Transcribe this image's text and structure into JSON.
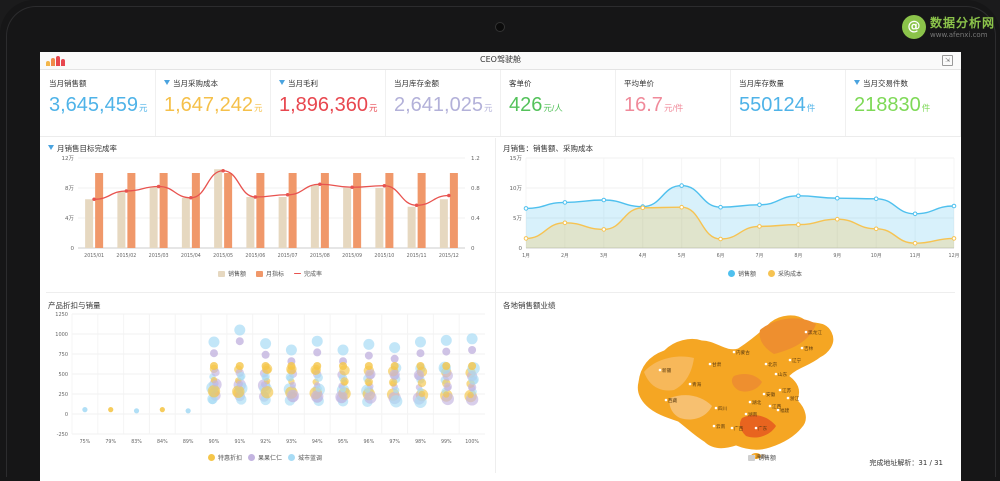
{
  "brand": {
    "name": "数据分析网",
    "url": "www.afenxi.com",
    "logo_glyph": "@"
  },
  "app": {
    "title": "CEO驾驶舱",
    "icon": "bar-logo-icon",
    "exit_icon": "exit-icon",
    "exit_glyph": "⇲"
  },
  "kpis": [
    {
      "label": "当月销售额",
      "value": "3,645,459",
      "unit": "元",
      "color": "#4fb3e8",
      "filter": false
    },
    {
      "label": "当月采购成本",
      "value": "1,647,242",
      "unit": "元",
      "color": "#f5c04a",
      "filter": true
    },
    {
      "label": "当月毛利",
      "value": "1,896,360",
      "unit": "元",
      "color": "#e8474f",
      "filter": true
    },
    {
      "label": "当月库存金额",
      "value": "2,641,025",
      "unit": "元",
      "color": "#b3b1d9",
      "filter": false
    },
    {
      "label": "客单价",
      "value": "426",
      "unit": "元/人",
      "color": "#54c25b",
      "filter": false
    },
    {
      "label": "平均单价",
      "value": "16.7",
      "unit": "元/件",
      "color": "#f08a9a",
      "filter": false
    },
    {
      "label": "当月库存数量",
      "value": "550124",
      "unit": "件",
      "color": "#4fb3e8",
      "filter": false
    },
    {
      "label": "当月交易件数",
      "value": "218830",
      "unit": "件",
      "color": "#7ed957",
      "filter": true
    }
  ],
  "panels": {
    "p1": {
      "title": "月销售目标完成率",
      "filter": true
    },
    "p2": {
      "title": "月销售：销售额、采购成本"
    },
    "p3": {
      "title": "产品折扣与销量"
    },
    "p4": {
      "title": "各地销售额业绩"
    }
  },
  "chart_data": [
    {
      "type": "bar",
      "title": "月销售目标完成率",
      "categories": [
        "2015/01",
        "2015/02",
        "2015/03",
        "2015/04",
        "2015/05",
        "2015/06",
        "2015/07",
        "2015/08",
        "2015/09",
        "2015/10",
        "2015/11",
        "2015/12"
      ],
      "y_ticks": [
        "0",
        "4万",
        "8万",
        "12万"
      ],
      "y2_ticks": [
        "0",
        "0.4",
        "0.8",
        "1.2"
      ],
      "ylim": [
        0,
        120000
      ],
      "y2lim": [
        0,
        1.2
      ],
      "series": [
        {
          "name": "销售额",
          "type": "bar",
          "color": "#e6d8c0",
          "values": [
            65000,
            75000,
            82000,
            67000,
            105000,
            68000,
            68000,
            84000,
            80000,
            80000,
            55000,
            65000
          ]
        },
        {
          "name": "月指标",
          "type": "bar",
          "color": "#f0986a",
          "values": [
            100000,
            100000,
            100000,
            100000,
            100000,
            100000,
            100000,
            100000,
            100000,
            100000,
            100000,
            100000
          ]
        },
        {
          "name": "完成率",
          "type": "line",
          "color": "#e8534f",
          "values": [
            0.65,
            0.76,
            0.82,
            0.67,
            1.03,
            0.68,
            0.71,
            0.85,
            0.81,
            0.83,
            0.57,
            0.7
          ]
        }
      ]
    },
    {
      "type": "area",
      "title": "月销售：销售额、采购成本",
      "categories": [
        "1月",
        "2月",
        "3月",
        "4月",
        "5月",
        "6月",
        "7月",
        "8月",
        "9月",
        "10月",
        "11月",
        "12月"
      ],
      "y_ticks": [
        "0",
        "5万",
        "10万",
        "15万"
      ],
      "ylim": [
        0,
        150000
      ],
      "series": [
        {
          "name": "销售额",
          "color": "#4fc0ee",
          "values": [
            66000,
            76000,
            80000,
            69000,
            104000,
            68000,
            72000,
            87000,
            83000,
            82000,
            57000,
            70000
          ]
        },
        {
          "name": "采购成本",
          "color": "#f6c352",
          "values": [
            16000,
            42000,
            31000,
            67000,
            68000,
            15000,
            36000,
            39000,
            48000,
            32000,
            8000,
            16000
          ]
        }
      ]
    },
    {
      "type": "scatter",
      "title": "产品折扣与销量",
      "categories": [
        "75%",
        "79%",
        "83%",
        "84%",
        "89%",
        "90%",
        "91%",
        "92%",
        "93%",
        "94%",
        "95%",
        "96%",
        "97%",
        "98%",
        "99%",
        "100%"
      ],
      "y_ticks": [
        "-250",
        "0",
        "250",
        "500",
        "750",
        "1000",
        "1250"
      ],
      "ylim": [
        -250,
        1250
      ],
      "series": [
        {
          "name": "特惠折扣",
          "color": "#f5c64a"
        },
        {
          "name": "果果仁仁",
          "color": "#c3b4e0"
        },
        {
          "name": "城市蓝调",
          "color": "#a8dcf5"
        }
      ]
    },
    {
      "type": "map",
      "title": "各地销售额业绩",
      "legend": [
        "销售额"
      ],
      "labels": [
        "新疆",
        "西藏",
        "青海",
        "甘肃",
        "四川",
        "内蒙古",
        "黑龙江",
        "吉林",
        "辽宁",
        "北京",
        "山东",
        "江苏",
        "安徽",
        "湖北",
        "湖南",
        "广东",
        "广西",
        "云南",
        "海南",
        "福建",
        "浙江",
        "江西"
      ]
    }
  ],
  "status": {
    "text": "完成地址解析：31 / 31"
  }
}
